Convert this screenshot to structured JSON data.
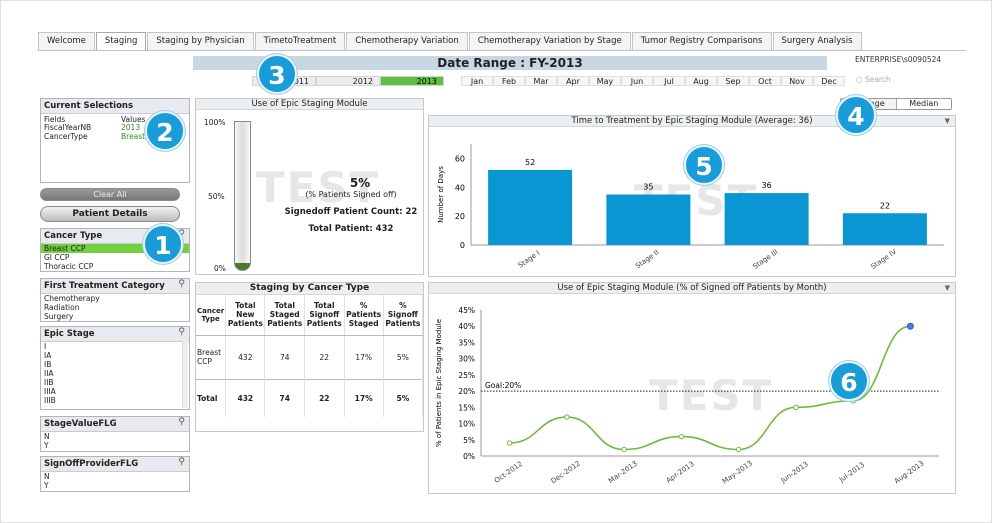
{
  "tabs": [
    "Welcome",
    "Staging",
    "Staging by Physician",
    "TimetoTreatment",
    "Chemotherapy Variation",
    "Chemotherapy Variation by Stage",
    "Tumor Registry Comparisons",
    "Surgery Analysis"
  ],
  "active_tab": "Staging",
  "header": {
    "date_range": "Date Range : FY-2013",
    "enterprise": "ENTERPRISE\\s0090524",
    "search_placeholder": "Search"
  },
  "years": [
    "2011",
    "2012",
    "2013"
  ],
  "selected_year": "2013",
  "months": [
    "Jan",
    "Feb",
    "Mar",
    "Apr",
    "May",
    "Jun",
    "Jul",
    "Aug",
    "Sep",
    "Oct",
    "Nov",
    "Dec"
  ],
  "current_selections": {
    "title": "Current Selections",
    "fields_label": "Fields",
    "values_label": "Values",
    "rows": [
      {
        "field": "FiscalYearNB",
        "value": "2013"
      },
      {
        "field": "CancerType",
        "value": "Breast CCP"
      }
    ]
  },
  "buttons": {
    "clear_all": "Clear All",
    "patient_details": "Patient Details",
    "average": "Average",
    "median": "Median"
  },
  "listboxes": [
    {
      "title": "Cancer Type",
      "items": [
        "Breast CCP",
        "GI CCP",
        "Thoracic CCP"
      ],
      "selected": "Breast CCP"
    },
    {
      "title": "First Treatment Category",
      "items": [
        "Chemotherapy",
        "Radiation",
        "Surgery"
      ]
    },
    {
      "title": "Epic Stage",
      "items": [
        "I",
        "IA",
        "IB",
        "IIA",
        "IIB",
        "IIIA",
        "IIIB"
      ]
    },
    {
      "title": "StageValueFLG",
      "items": [
        "N",
        "Y"
      ]
    },
    {
      "title": "SignOffProviderFLG",
      "items": [
        "N",
        "Y"
      ]
    }
  ],
  "badges": [
    "1",
    "2",
    "3",
    "4",
    "5",
    "6"
  ],
  "watermark": "TEST",
  "gauge": {
    "title": "Use of Epic Staging Module",
    "pct": "5%",
    "pct_value": 5,
    "pct_label": "(% Patients Signed off)",
    "signedoff": "Signedoff Patient Count: 22",
    "total": "Total Patient: 432",
    "axis": [
      "100%",
      "50%",
      "0%"
    ]
  },
  "staging_table": {
    "title": "Staging by Cancer Type",
    "headers": [
      "Cancer Type",
      "Total New Patients",
      "Total Staged Patients",
      "Total Signoff Patients",
      "% Patients Staged",
      "% Signoff Patients"
    ],
    "rows": [
      [
        "Breast CCP",
        "432",
        "74",
        "22",
        "17%",
        "5%"
      ]
    ],
    "total": [
      "Total",
      "432",
      "74",
      "22",
      "17%",
      "5%"
    ]
  },
  "chart_data": [
    {
      "type": "bar",
      "title": "Time to Treatment by Epic Staging Module (Average: 36)",
      "categories": [
        "Stage I",
        "Stage II",
        "Stage III",
        "Stage IV"
      ],
      "values": [
        52,
        35,
        36,
        22
      ],
      "ylabel": "Number of Days",
      "ylim": [
        0,
        70
      ],
      "yticks": [
        "0",
        "20",
        "40",
        "60"
      ],
      "color": "#0a96d2"
    },
    {
      "type": "line",
      "title": "Use of Epic Staging Module (% of Signed off Patients by Month)",
      "categories": [
        "Oct-2012",
        "Dec-2012",
        "Mar-2013",
        "Apr-2013",
        "May-2013",
        "Jun-2013",
        "Jul-2013",
        "Aug-2013"
      ],
      "values": [
        4,
        12,
        2,
        6,
        2,
        15,
        17,
        40
      ],
      "ylabel": "% of Patients in Epic Staging Module",
      "ylim": [
        0,
        45
      ],
      "yticks": [
        "0%",
        "5%",
        "10%",
        "15%",
        "20%",
        "25%",
        "30%",
        "35%",
        "40%",
        "45%"
      ],
      "goal": 20,
      "goal_label": "Goal:20%",
      "color": "#6cbb3c"
    }
  ]
}
